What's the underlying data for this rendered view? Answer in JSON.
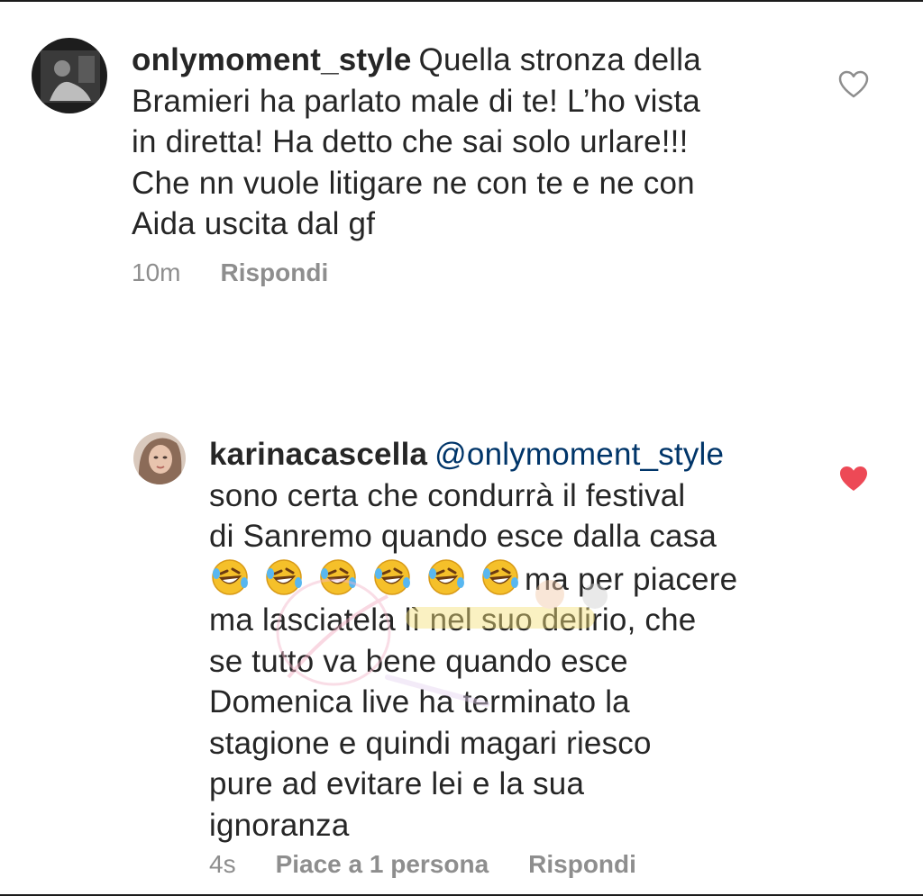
{
  "comments": [
    {
      "username": "onlymoment_style",
      "text_lines": [
        "Quella stronza della",
        "Bramieri ha parlato male di te! L’ho vista",
        "in diretta! Ha detto che sai solo urlare!!!",
        "Che nn vuole litigare ne con te e ne con",
        "Aida uscita dal gf"
      ],
      "time": "10m",
      "reply_label": "Rispondi",
      "liked": false,
      "like_icon": "heart-outline-icon"
    },
    {
      "username": "karinacascella",
      "mention": "@onlymoment_style",
      "text_lines": [
        "sono certa che condurrà il festival",
        "di Sanremo quando esce dalla casa",
        "ma per piacere",
        "ma lasciatela lì nel suo delirio, che",
        "se tutto va bene quando esce",
        "Domenica live ha terminato la",
        "stagione e quindi magari riesco",
        "pure ad evitare lei e la sua",
        "ignoranza"
      ],
      "emoji": [
        "🤣",
        "🤣",
        "🤣",
        "🤣",
        "🤣",
        "🤣"
      ],
      "time": "4s",
      "likes_label": "Piace a 1 persona",
      "reply_label": "Rispondi",
      "liked": true,
      "like_icon": "heart-filled-icon"
    }
  ],
  "colors": {
    "text": "#262626",
    "muted": "#8e8e8e",
    "mention": "#003569",
    "like": "#ed4956"
  }
}
